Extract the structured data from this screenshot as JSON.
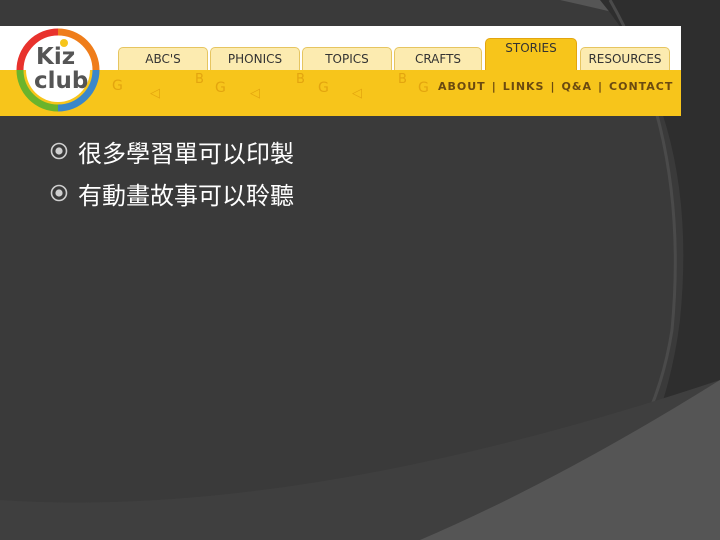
{
  "header": {
    "logo": {
      "line1": "Kiz",
      "line2": "club"
    },
    "tabs": [
      {
        "label": "ABC'S",
        "active": false
      },
      {
        "label": "PHONICS",
        "active": false
      },
      {
        "label": "TOPICS",
        "active": false
      },
      {
        "label": "CRAFTS",
        "active": false
      },
      {
        "label": "STORIES",
        "active": true
      },
      {
        "label": "RESOURCES",
        "active": false
      }
    ],
    "subnav": [
      "ABOUT",
      "LINKS",
      "Q&A",
      "CONTACT"
    ],
    "subnav_separator": "|"
  },
  "bullets": [
    {
      "text": "很多學習單可以印製",
      "icon": "circle-target-icon"
    },
    {
      "text": "有動畫故事可以聆聽",
      "icon": "circle-target-icon"
    }
  ],
  "colors": {
    "slide_bg": "#3a3a3a",
    "banner_yellow": "#f7c51b",
    "tab_bg": "#fcebb0",
    "text": "#ffffff"
  }
}
